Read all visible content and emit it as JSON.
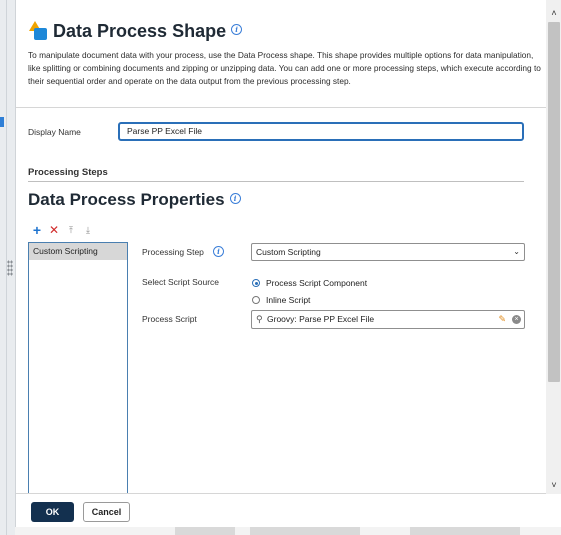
{
  "dialog": {
    "title": "Data Process Shape",
    "description": "To manipulate document data with your process, use the Data Process shape. This shape provides multiple options for data manipulation, like splitting or combining documents and zipping or unzipping data. You can add one or more processing steps, which execute according to their sequential order and operate on the data output from the previous processing step."
  },
  "display_name": {
    "label": "Display Name",
    "value": "Parse PP Excel File"
  },
  "processing_steps": {
    "section_title": "Processing Steps",
    "properties_title": "Data Process Properties",
    "toolbar": {
      "add_icon": "+",
      "delete_icon": "✕",
      "move_up_icon": "⤒",
      "move_down_icon": "⤓"
    },
    "steps": [
      {
        "label": "Custom Scripting"
      }
    ]
  },
  "properties": {
    "processing_step_label": "Processing Step",
    "processing_step_value": "Custom Scripting",
    "script_source_label": "Select Script Source",
    "script_source_options": [
      {
        "label": "Process Script Component",
        "selected": true
      },
      {
        "label": "Inline Script",
        "selected": false
      }
    ],
    "process_script_label": "Process Script",
    "process_script_value": "Groovy: Parse PP Excel File"
  },
  "footer": {
    "ok_label": "OK",
    "cancel_label": "Cancel"
  },
  "colors": {
    "primary_button": "#13304f",
    "accent": "#2a6fb8",
    "delete": "#d12c2c"
  }
}
